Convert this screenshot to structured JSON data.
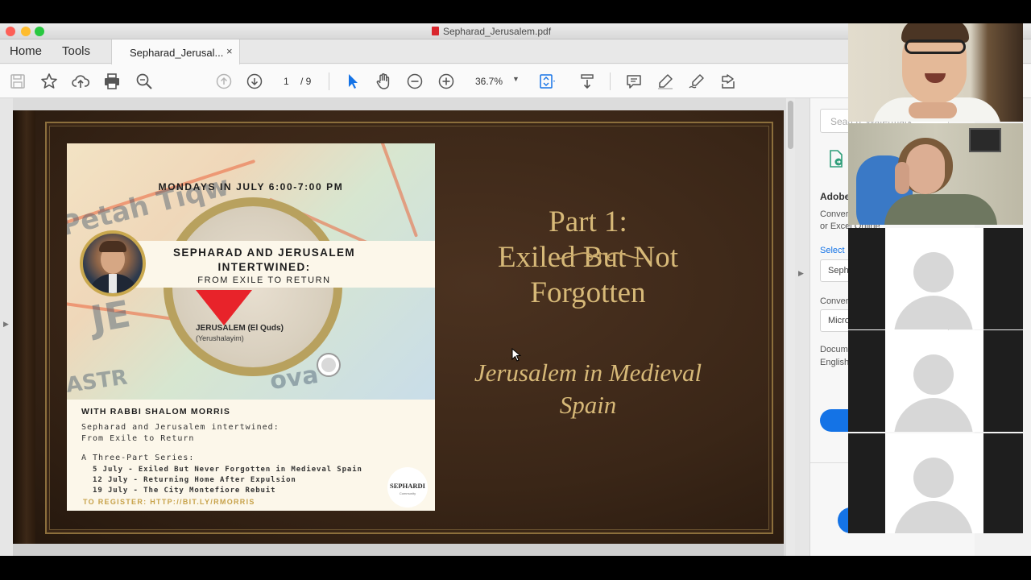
{
  "window": {
    "title": "Sepharad_Jerusalem.pdf"
  },
  "tabs": {
    "home": "Home",
    "tools": "Tools",
    "document": "Sepharad_Jerusal...",
    "close_symbol": "×"
  },
  "toolbar": {
    "page_current": "1",
    "page_total": "/ 9",
    "zoom": "36.7%"
  },
  "poster": {
    "schedule": "MONDAYS IN JULY 6:00-7:00 PM",
    "title_line1": "SEPHARAD AND JERUSALEM",
    "title_line2": "INTERTWINED:",
    "title_line3": "FROM EXILE TO RETURN",
    "map_label_1": "JERUSALEM (El Quds)",
    "map_label_2": "(Yerushalayim)",
    "map_bg_1": "Petah Tiqw",
    "map_bg_2": "JE",
    "map_bg_3": "ZASTR",
    "map_bg_4": "ova",
    "with": "WITH RABBI SHALOM MORRIS",
    "desc_line1": "Sepharad and Jerusalem intertwined:",
    "desc_line2": "From Exile to Return",
    "series_heading": "A Three-Part Series:",
    "series": [
      "5 July  - Exiled But Never Forgotten in Medieval Spain",
      "12 July - Returning Home After Expulsion",
      "19 July - The City Montefiore Rebuit"
    ],
    "register": "TO REGISTER: HTTP://BIT.LY/RMORRIS",
    "logo_text": "SEPHARDI",
    "logo_sub": "Community"
  },
  "slide": {
    "title_line1": "Part 1:",
    "title_line2": "Exiled But Not",
    "title_line3": "Forgotten",
    "subtitle_line1": "Jerusalem in Medieval",
    "subtitle_line2": "Spain"
  },
  "right_panel": {
    "search_placeholder": "Search 'Watermark'",
    "heading": "Adobe",
    "text1": "Conver",
    "text2": "or Excel Online",
    "select_label": "Select",
    "file_box": "Seph",
    "convert_label": "Conver",
    "format_box": "Micro",
    "doc_label": "Docum",
    "doc_lang": "English"
  },
  "colors": {
    "accent_blue": "#1473e6",
    "slide_gold": "#d7b978",
    "page_brown": "#3a2616",
    "pin_red": "#e8232a"
  }
}
